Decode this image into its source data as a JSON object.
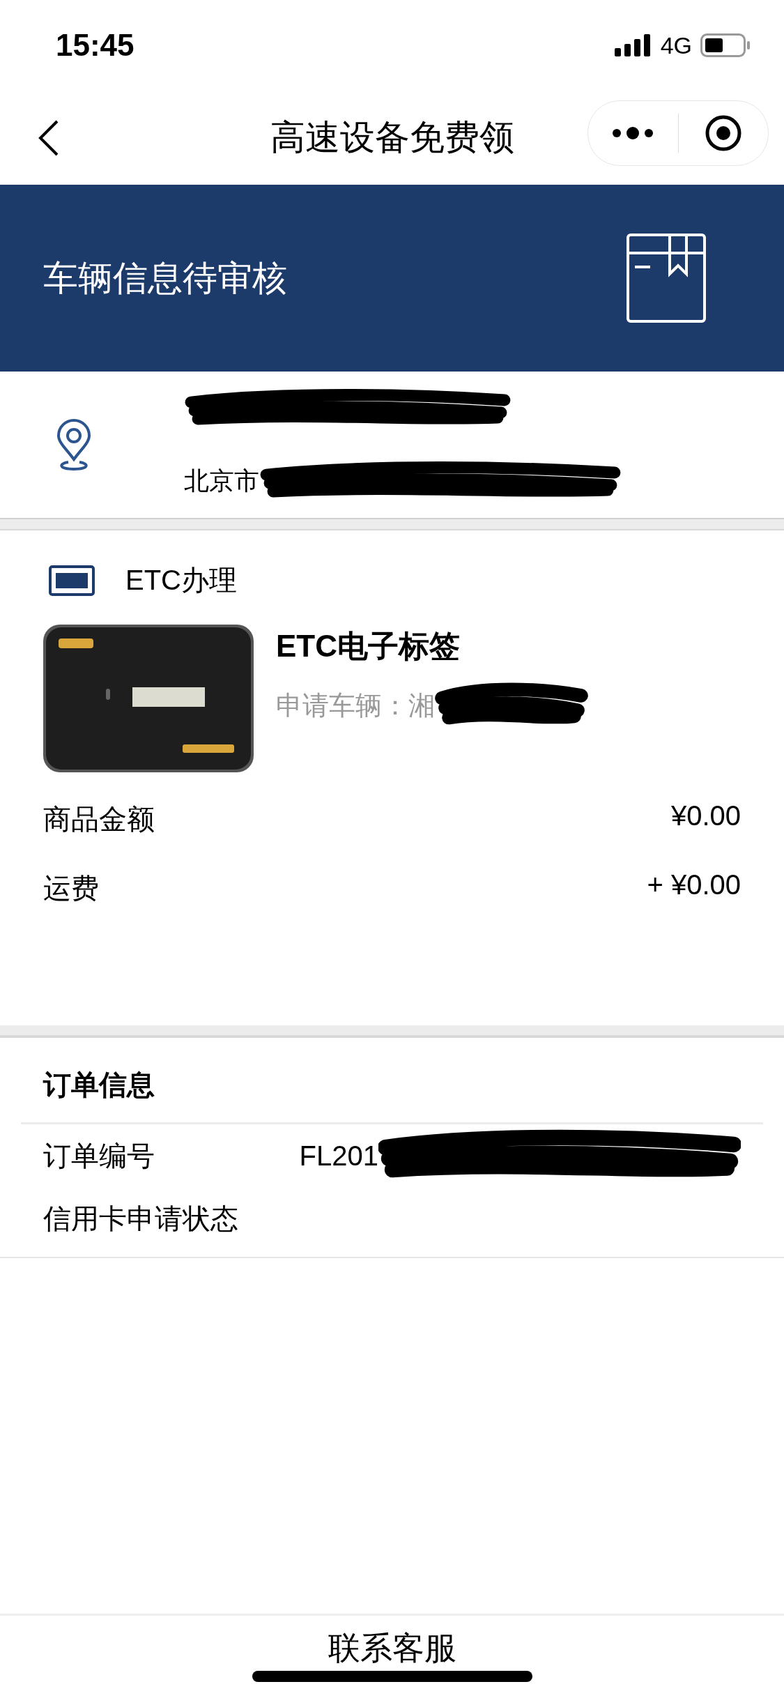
{
  "status_bar": {
    "time": "15:45",
    "network": "4G"
  },
  "nav": {
    "title": "高速设备免费领"
  },
  "banner": {
    "title": "车辆信息待审核"
  },
  "address": {
    "line_2": "北京市"
  },
  "product_section": {
    "heading": "ETC办理",
    "product_name": "ETC电子标签",
    "vehicle_label": "申请车辆：",
    "vehicle_value": "湘"
  },
  "costs": [
    {
      "label": "商品金额",
      "value": "¥0.00"
    },
    {
      "label": "运费",
      "value": "+ ¥0.00"
    }
  ],
  "order_info": {
    "heading": "订单信息",
    "rows": [
      {
        "label": "订单编号",
        "value": "FL201"
      },
      {
        "label": "信用卡申请状态"
      }
    ]
  },
  "footer_button": "联系客服"
}
